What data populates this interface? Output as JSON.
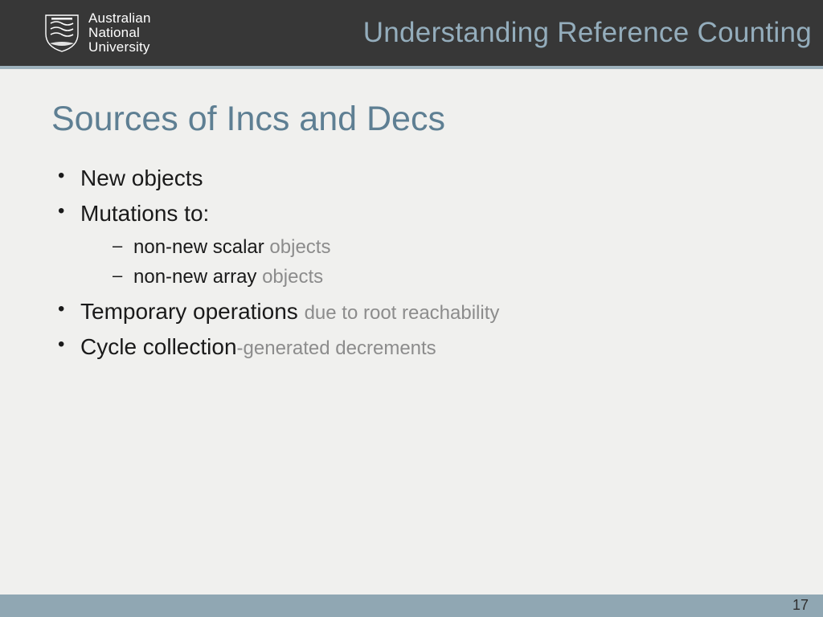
{
  "header": {
    "uni_line1": "Australian",
    "uni_line2": "National",
    "uni_line3": "University",
    "title": "Understanding Reference Counting"
  },
  "slide": {
    "title": "Sources of Incs and Decs",
    "bullets": {
      "b1": "New objects",
      "b2": "Mutations to:",
      "b2a_main": "non-new scalar ",
      "b2a_muted": "objects",
      "b2b_main": "non-new array ",
      "b2b_muted": "objects",
      "b3_main": "Temporary operations ",
      "b3_muted": "due to root reachability",
      "b4_main": "Cycle collection",
      "b4_muted": "-generated decrements"
    }
  },
  "footer": {
    "page": "17"
  }
}
